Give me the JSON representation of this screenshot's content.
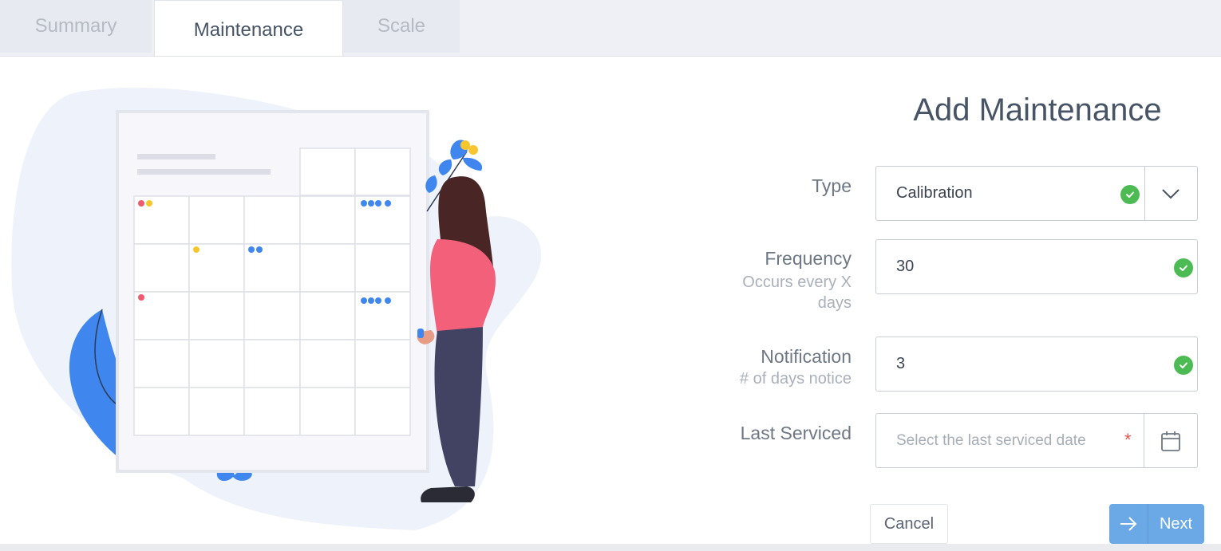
{
  "tabs": [
    {
      "label": "Summary",
      "active": false
    },
    {
      "label": "Maintenance",
      "active": true
    },
    {
      "label": "Scale",
      "active": false
    }
  ],
  "form": {
    "title": "Add Maintenance",
    "type": {
      "label": "Type",
      "value": "Calibration",
      "valid": true,
      "icon": "chevron-down-icon"
    },
    "frequency": {
      "label": "Frequency",
      "sublabel_line1": "Occurs every X",
      "sublabel_line2": "days",
      "value": "30",
      "valid": true
    },
    "notification": {
      "label": "Notification",
      "sublabel": "# of days notice",
      "value": "3",
      "valid": true
    },
    "last_serviced": {
      "label": "Last Serviced",
      "placeholder": "Select the last serviced date",
      "required_mark": "*",
      "icon": "calendar-icon"
    }
  },
  "actions": {
    "cancel_label": "Cancel",
    "next_label": "Next"
  },
  "colors": {
    "accent_green": "#4caf50",
    "valid_green": "#4cbb54",
    "primary_blue": "#6aa9e6",
    "required_red": "#e8554e"
  }
}
